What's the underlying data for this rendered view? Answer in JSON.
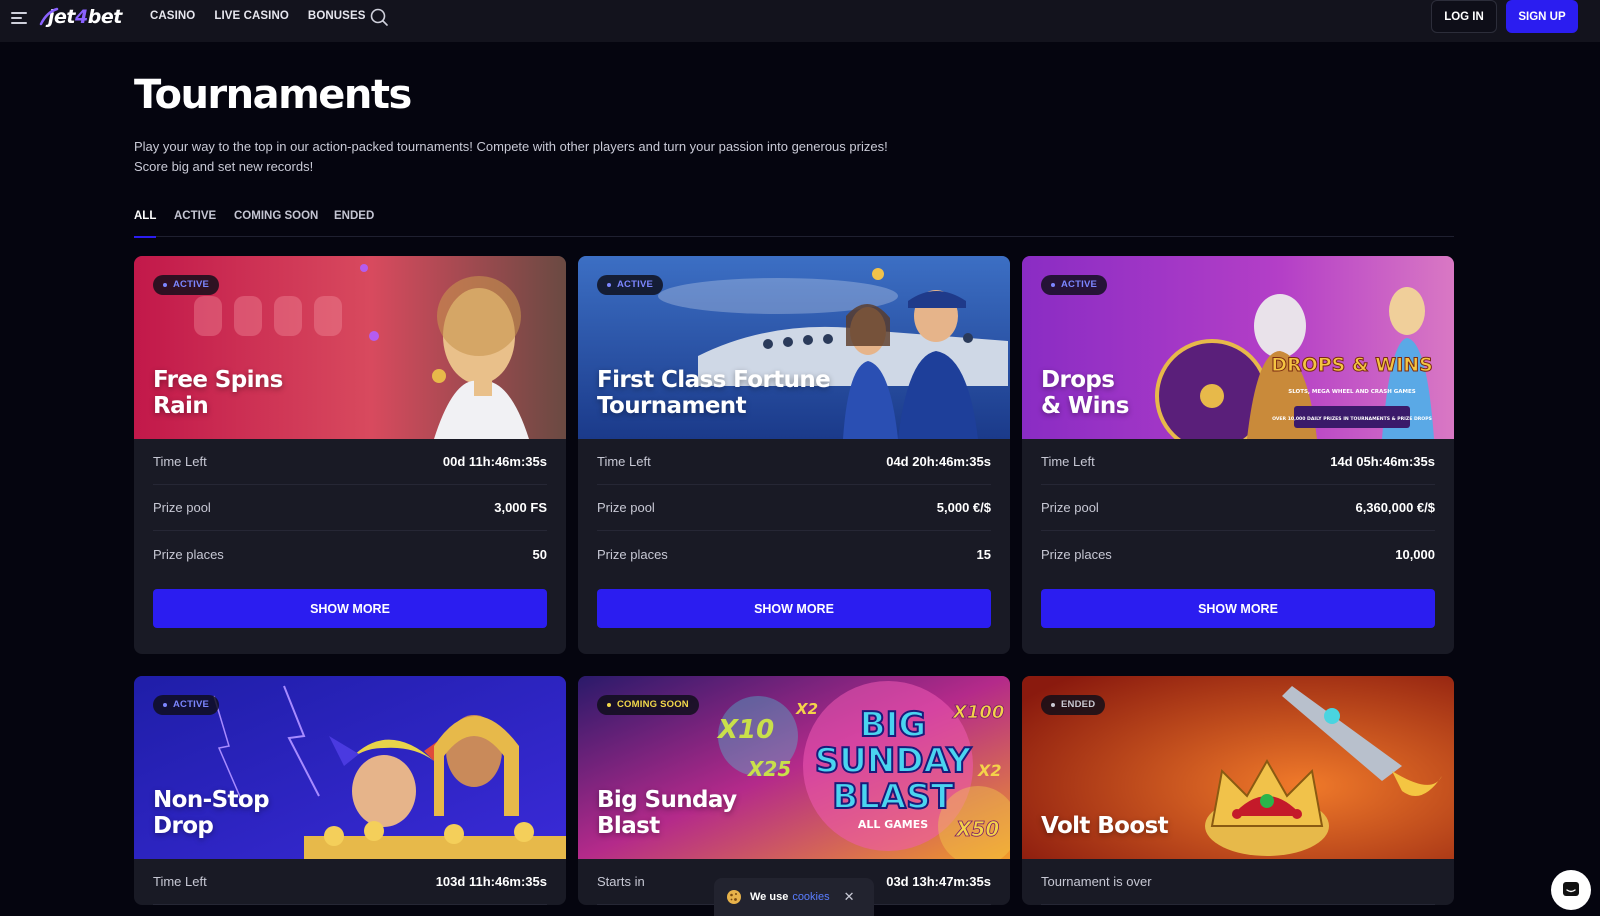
{
  "header": {
    "logo": "jet4bet",
    "nav": [
      "CASINO",
      "LIVE CASINO",
      "BONUSES"
    ],
    "login_label": "LOG IN",
    "signup_label": "SIGN UP"
  },
  "page": {
    "title": "Tournaments",
    "description_line1": "Play your way to the top in our action-packed tournaments! Compete with other players and turn your passion into generous prizes!",
    "description_line2": "Score big and set new records!"
  },
  "tabs": [
    "ALL",
    "ACTIVE",
    "COMING SOON",
    "ENDED"
  ],
  "cards": [
    {
      "status": "ACTIVE",
      "title_line1": "Free Spins",
      "title_line2": "Rain",
      "rows": [
        {
          "label": "Time Left",
          "value": "00d 11h:46m:35s"
        },
        {
          "label": "Prize pool",
          "value": "3,000 FS"
        },
        {
          "label": "Prize places",
          "value": "50"
        }
      ],
      "button": "SHOW MORE"
    },
    {
      "status": "ACTIVE",
      "title_line1": "First Class Fortune",
      "title_line2": "Tournament",
      "rows": [
        {
          "label": "Time Left",
          "value": "04d 20h:46m:35s"
        },
        {
          "label": "Prize pool",
          "value": "5,000 €/$"
        },
        {
          "label": "Prize places",
          "value": "15"
        }
      ],
      "button": "SHOW MORE"
    },
    {
      "status": "ACTIVE",
      "title_line1": "Drops",
      "title_line2": "& Wins",
      "art_text": {
        "headline": "DROPS & WINS",
        "sub": "SLOTS, MEGA WHEEL AND CRASH GAMES",
        "banner": "OVER 10,000 DAILY PRIZES IN TOURNAMENTS & PRIZE DROPS"
      },
      "rows": [
        {
          "label": "Time Left",
          "value": "14d 05h:46m:35s"
        },
        {
          "label": "Prize pool",
          "value": "6,360,000 €/$"
        },
        {
          "label": "Prize places",
          "value": "10,000"
        }
      ],
      "button": "SHOW MORE"
    },
    {
      "status": "ACTIVE",
      "title_line1": "Non-Stop",
      "title_line2": "Drop",
      "rows": [
        {
          "label": "Time Left",
          "value": "103d 11h:46m:35s"
        }
      ]
    },
    {
      "status": "COMING SOON",
      "title_line1": "Big Sunday",
      "title_line2": "Blast",
      "art_text": {
        "l1": "BIG",
        "l2": "SUNDAY",
        "l3": "BLAST",
        "sub": "ALL GAMES",
        "m1": "X10",
        "m2": "X2",
        "m3": "X25",
        "m4": "X100",
        "m5": "X50"
      },
      "rows": [
        {
          "label": "Starts in",
          "value": "03d 13h:47m:35s"
        }
      ]
    },
    {
      "status": "ENDED",
      "title_line1": "Volt Boost",
      "title_line2": "",
      "rows": [
        {
          "label": "Tournament is over",
          "value": ""
        }
      ]
    }
  ],
  "cookie": {
    "text": "We use",
    "link": "cookies",
    "close": "✕"
  },
  "colors": {
    "accent": "#2b1df0",
    "background": "#05050f",
    "card": "#191a25",
    "header": "#13131d"
  }
}
